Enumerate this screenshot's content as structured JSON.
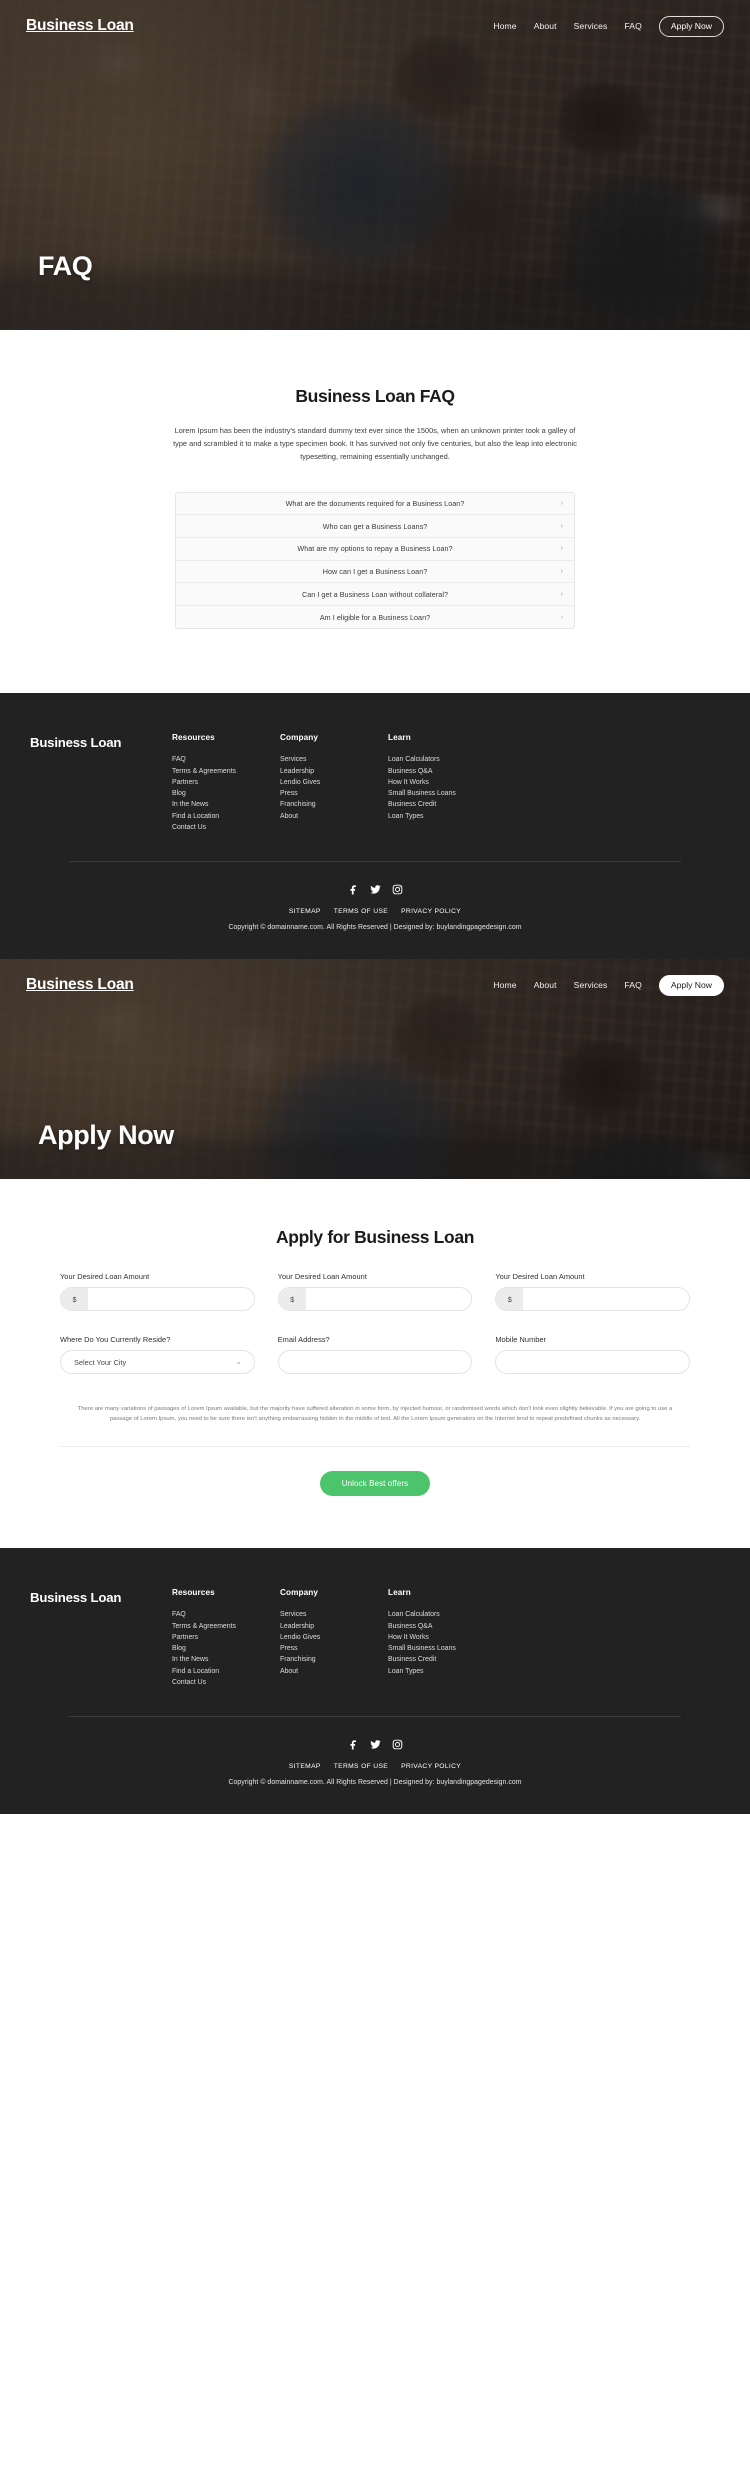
{
  "brand": "Business Loan",
  "nav": {
    "links": [
      "Home",
      "About",
      "Services",
      "FAQ"
    ],
    "cta": "Apply Now"
  },
  "hero_faq": {
    "title": "FAQ"
  },
  "hero_apply": {
    "title": "Apply Now"
  },
  "faq_section": {
    "title": "Business Loan FAQ",
    "lede": "Lorem Ipsum has been the industry's standard dummy text ever since the 1500s, when an unknown printer took a galley of type and scrambled it to make a type specimen book. It has survived not only five centuries, but also the leap into electronic typesetting, remaining essentially unchanged.",
    "chevron_icon": "›",
    "items": [
      "What are the documents required for a Business Loan?",
      "Who can get a Business Loans?",
      "What are my options to repay a Business Loan?",
      "How can I get a Business Loan?",
      "Can I get a Business Loan without collateral?",
      "Am I eligible for a Business Loan?"
    ]
  },
  "apply_section": {
    "title": "Apply for Business Loan",
    "fields": {
      "amount1": {
        "label": "Your Desired Loan Amount",
        "prefix": "$",
        "value": "",
        "placeholder": ""
      },
      "amount2": {
        "label": "Your Desired Loan Amount",
        "prefix": "$",
        "value": "",
        "placeholder": ""
      },
      "amount3": {
        "label": "Your Desired Loan Amount",
        "prefix": "$",
        "value": "",
        "placeholder": ""
      },
      "city": {
        "label": "Where Do You Currently Reside?",
        "value": "Select Your City",
        "chevron_icon": "⌄"
      },
      "email": {
        "label": "Email Address?",
        "value": "",
        "placeholder": ""
      },
      "mobile": {
        "label": "Mobile Number",
        "value": "",
        "placeholder": ""
      }
    },
    "note": "There are many variations of passages of Lorem Ipsum available, but the majority have suffered alteration in some form, by injected humour, or randomised words which don't look even slightly believable. If you are going to use a passage of Lorem Ipsum, you need to be sure there isn't anything embarrassing hidden in the middle of text. All the Lorem Ipsum generators on the Internet tend to repeat predefined chunks as necessary.",
    "submit_label": "Unlock Best offers",
    "submit_color": "#4cc46c"
  },
  "footer": {
    "brand": "Business Loan",
    "columns": [
      {
        "heading": "Resources",
        "links": [
          "FAQ",
          "Terms & Agreements",
          "Partners",
          "Blog",
          "In the News",
          "Find a Location",
          "Contact Us"
        ]
      },
      {
        "heading": "Company",
        "links": [
          "Services",
          "Leadership",
          "Lendio Gives",
          "Press",
          "Franchising",
          "About"
        ]
      },
      {
        "heading": "Learn",
        "links": [
          "Loan Calculators",
          "Business Q&A",
          "How It Works",
          "Small Business Loans",
          "Business Credit",
          "Loan Types"
        ]
      }
    ],
    "socials": [
      "facebook-icon",
      "twitter-icon",
      "instagram-icon"
    ],
    "legal_links": [
      "SITEMAP",
      "TERMS OF USE",
      "PRIVACY POLICY"
    ],
    "copyright": "Copyright © domainname.com. All Rights Reserved | Designed by: buylandingpagedesign.com",
    "background": "#222222"
  }
}
